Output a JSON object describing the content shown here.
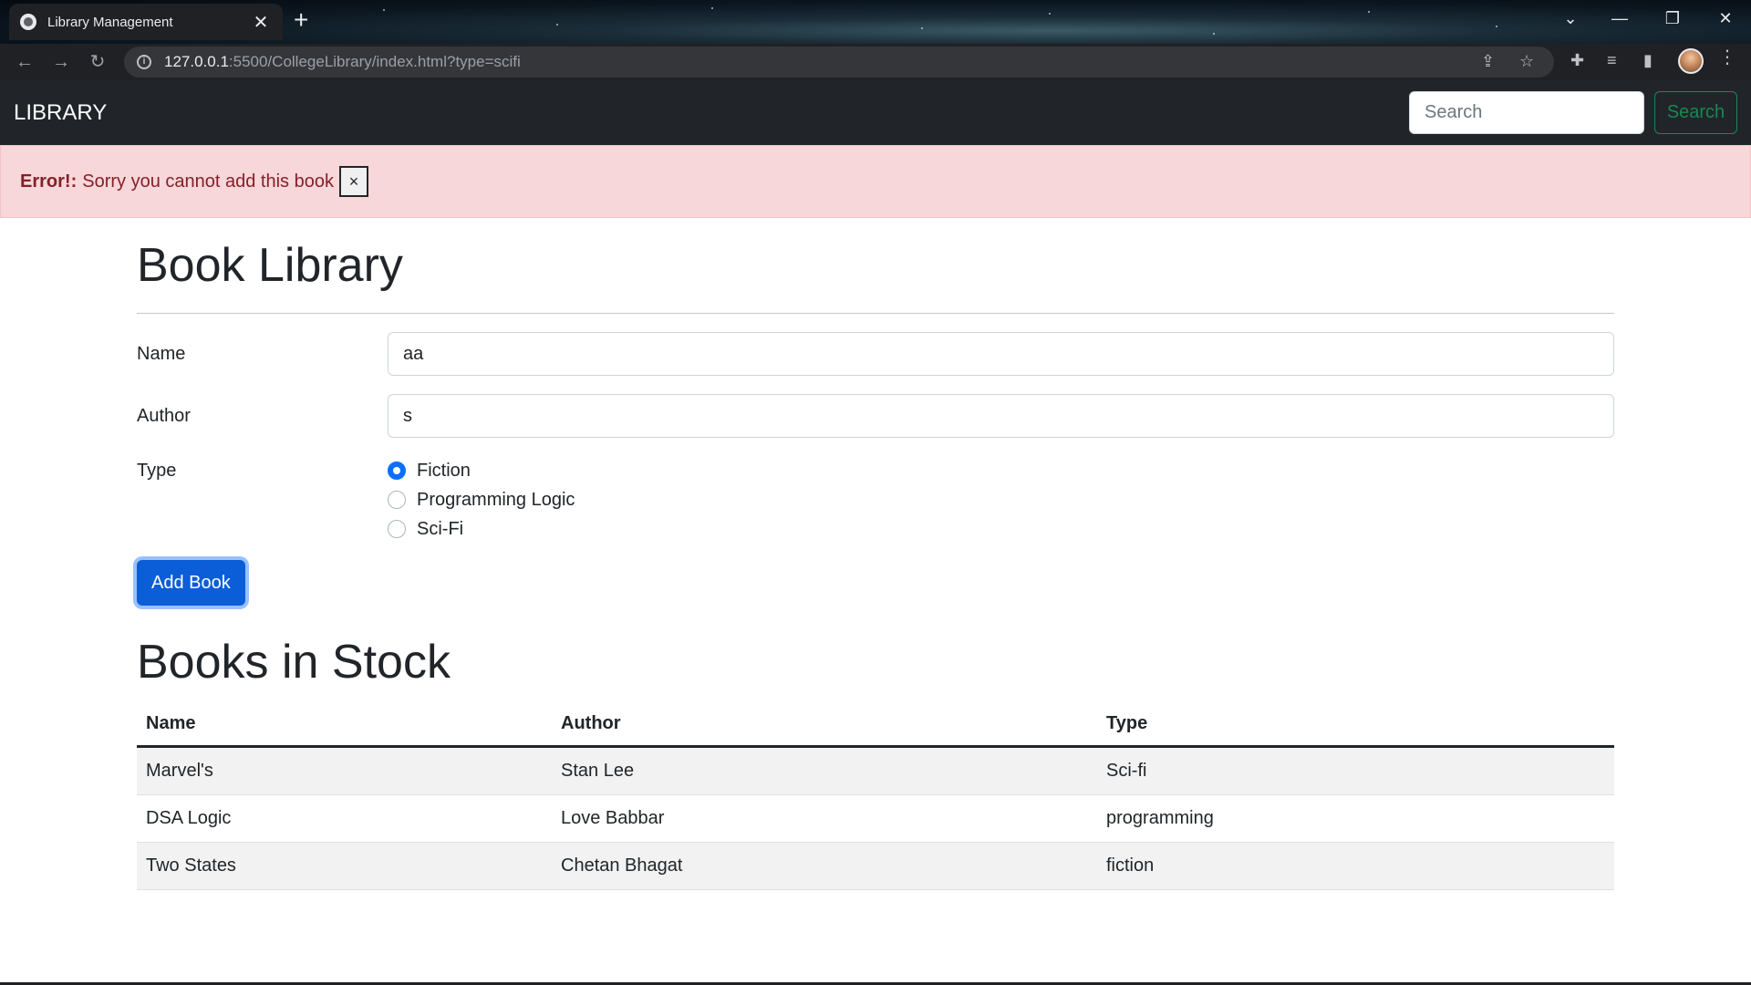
{
  "browser": {
    "tab_title": "Library Management",
    "url_host": "127.0.0.1",
    "url_rest": ":5500/CollegeLibrary/index.html?type=scifi"
  },
  "navbar": {
    "brand": "LIBRARY",
    "search_placeholder": "Search",
    "search_button": "Search"
  },
  "alert": {
    "strong": "Error!:",
    "message": "Sorry you cannot add this book",
    "close": "×"
  },
  "form": {
    "title": "Book Library",
    "name_label": "Name",
    "name_value": "aa",
    "author_label": "Author",
    "author_value": "s",
    "type_label": "Type",
    "types": [
      {
        "label": "Fiction",
        "checked": true
      },
      {
        "label": "Programming Logic",
        "checked": false
      },
      {
        "label": "Sci-Fi",
        "checked": false
      }
    ],
    "submit": "Add Book"
  },
  "stock": {
    "title": "Books in Stock",
    "headers": [
      "Name",
      "Author",
      "Type"
    ],
    "rows": [
      [
        "Marvel's",
        "Stan Lee",
        "Sci-fi"
      ],
      [
        "DSA Logic",
        "Love Babbar",
        "programming"
      ],
      [
        "Two States",
        "Chetan Bhagat",
        "fiction"
      ]
    ]
  },
  "colors": {
    "navbar_bg": "#212529",
    "alert_bg": "#f8d7da",
    "primary": "#0d6efd",
    "success": "#198754"
  }
}
